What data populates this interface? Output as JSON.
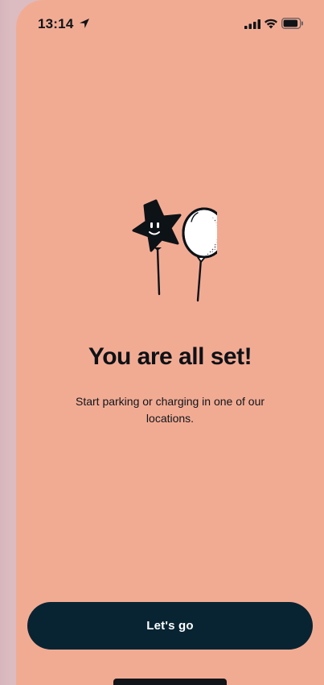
{
  "status_bar": {
    "time": "13:14",
    "location_icon": "location-arrow-icon",
    "signal_icon": "cellular-signal-icon",
    "wifi_icon": "wifi-icon",
    "battery_icon": "battery-icon"
  },
  "illustration": {
    "icon": "balloons-icon"
  },
  "main": {
    "title": "You are all set!",
    "subtitle": "Start parking or charging in one of our locations."
  },
  "actions": {
    "primary_label": "Let's go"
  },
  "colors": {
    "background": "#f2ab93",
    "button": "#082432",
    "text": "#0d1217"
  }
}
